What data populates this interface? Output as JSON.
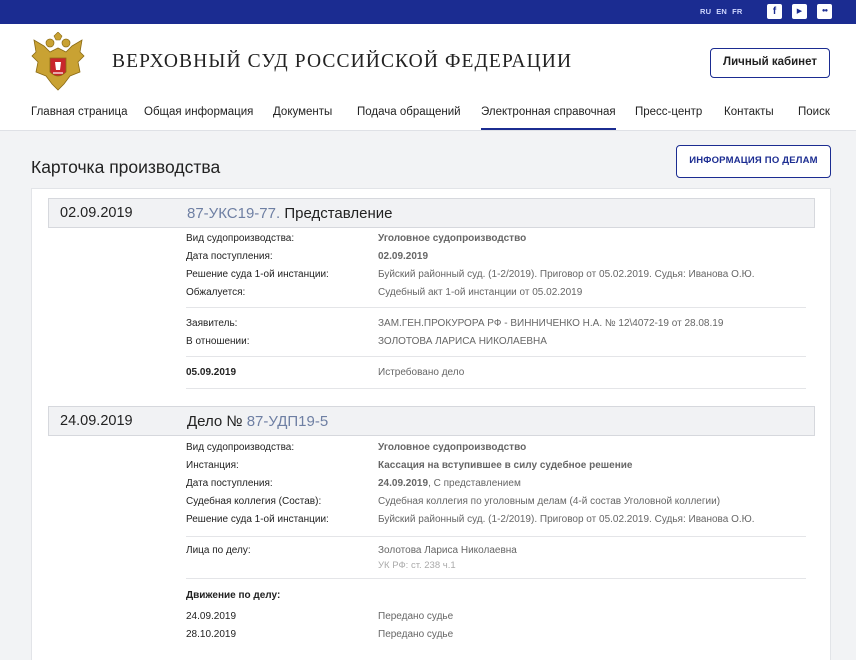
{
  "topbar": {
    "langs": [
      "RU",
      "EN",
      "FR"
    ],
    "social": [
      {
        "icon": "facebook-icon",
        "glyph": "f"
      },
      {
        "icon": "youtube-icon",
        "glyph": "▶"
      },
      {
        "icon": "flickr-icon",
        "glyph": "●●"
      }
    ]
  },
  "header": {
    "title": "ВЕРХОВНЫЙ СУД РОССИЙСКОЙ ФЕДЕРАЦИИ",
    "cabinet_label": "Личный кабинет",
    "emblem_icon": "coat-of-arms-icon"
  },
  "nav": [
    "Главная страница",
    "Общая информация",
    "Документы",
    "Подача обращений",
    "Электронная справочная",
    "Пресс-центр",
    "Контакты",
    "Поиск"
  ],
  "nav_active": "Электронная справочная",
  "page": {
    "title": "Карточка производства",
    "info_button": "ИНФОРМАЦИЯ ПО ДЕЛАМ"
  },
  "case1": {
    "date": "02.09.2019",
    "number": "87-УКС19-77.",
    "kind": " Представление",
    "rows": [
      {
        "label": "Вид судопроизводства:",
        "value": "Уголовное судопроизводство"
      },
      {
        "label": "Дата поступления:",
        "value": "02.09.2019"
      },
      {
        "label": "Решение суда 1-ой инстанции:",
        "value": "Буйский районный суд. (1-2/2019).  Приговор от 05.02.2019.  Судья: Иванова О.Ю."
      },
      {
        "label": "Обжалуется:",
        "value": "Судебный акт 1-ой инстанции от 05.02.2019"
      }
    ],
    "parties": [
      {
        "label": "Заявитель:",
        "value": "ЗАМ.ГЕН.ПРОКУРОРА РФ - ВИННИЧЕНКО Н.А. № 12\\4072-19 от 28.08.19"
      },
      {
        "label": "В отношении:",
        "value": "ЗОЛОТОВА ЛАРИСА НИКОЛАЕВНА"
      }
    ],
    "event": {
      "date": "05.09.2019",
      "status": "Истребовано дело"
    }
  },
  "case2": {
    "date": "24.09.2019",
    "prefix": "Дело № ",
    "number": "87-УДП19-5",
    "rows": [
      {
        "label": "Вид судопроизводства:",
        "value": "Уголовное судопроизводство"
      },
      {
        "label": "Инстанция:",
        "value": "Кассация на вступившее в силу судебное решение"
      },
      {
        "label": "Дата поступления:",
        "value_date": "24.09.2019",
        "value_rest": ", С представлением"
      },
      {
        "label": "Судебная коллегия (Состав):",
        "value": "Судебная коллегия по уголовным делам  (4-й состав Уголовной коллегии)"
      },
      {
        "label": "Решение суда 1-ой инстанции:",
        "value": "Буйский районный суд. (1-2/2019).  Приговор от 05.02.2019.  Судья: Иванова О.Ю."
      }
    ],
    "persons_label": "Лица по делу:",
    "person_name": "Золотова Лариса Николаевна",
    "person_article": "УК РФ: ст. 238 ч.1",
    "movement_label": "Движение по делу:",
    "movement": [
      {
        "date": "24.09.2019",
        "status": "Передано судье"
      },
      {
        "date": "28.10.2019",
        "status": "Передано судье"
      }
    ]
  },
  "colors": {
    "brand": "#1b2c91",
    "link": "#6e7fa3"
  }
}
